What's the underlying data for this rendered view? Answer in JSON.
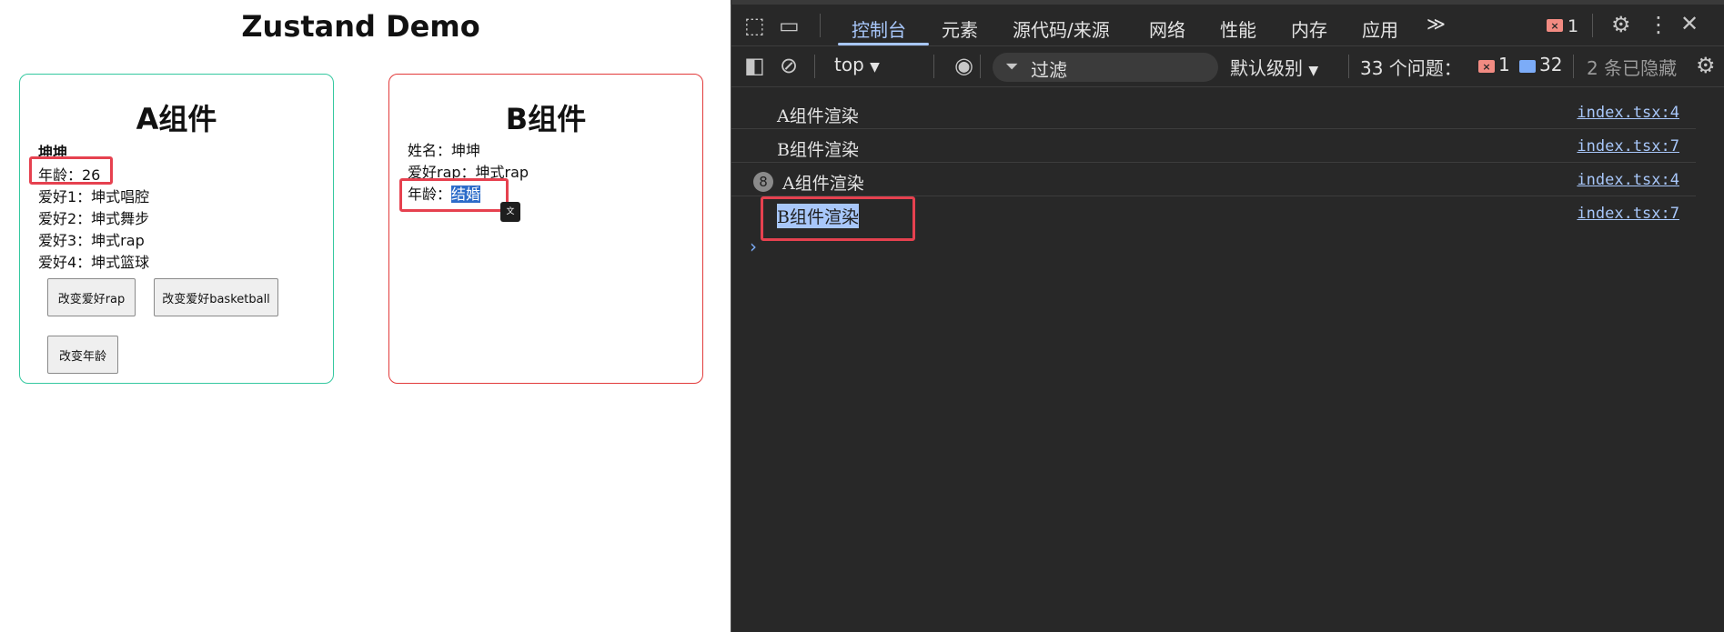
{
  "app": {
    "title": "Zustand Demo",
    "card_a": {
      "title": "A组件",
      "name": "坤坤",
      "age_line": "年龄：26",
      "hobbies": [
        "爱好1：坤式唱腔",
        "爱好2：坤式舞步",
        "爱好3：坤式rap",
        "爱好4：坤式篮球"
      ],
      "buttons": {
        "change_rap": "改变爱好rap",
        "change_basketball": "改变爱好basketball",
        "change_age": "改变年龄"
      }
    },
    "card_b": {
      "title": "B组件",
      "name_line": "姓名：坤坤",
      "hobby_line": "爱好rap：坤式rap",
      "age_label": "年龄：",
      "age_value": "结婚"
    },
    "colors": {
      "card_a_border": "#35c8a0",
      "card_b_border": "#e23b3b",
      "highlight_box": "#e6414f",
      "selection": "#2d6cc9"
    }
  },
  "devtools": {
    "tabs": [
      "控制台",
      "元素",
      "源代码/来源",
      "网络",
      "性能",
      "内存",
      "应用"
    ],
    "active_tab": "控制台",
    "more_tabs_glyph": "≫",
    "error_count": "1",
    "toolbar": {
      "context": "top",
      "filter_placeholder": "过滤",
      "level": "默认级别",
      "issues_label": "33 个问题：",
      "issues_errors": "1",
      "issues_messages": "32",
      "hidden": "2 条已隐藏"
    },
    "logs": [
      {
        "message": "A组件渲染",
        "source": "index.tsx:4",
        "count": ""
      },
      {
        "message": "B组件渲染",
        "source": "index.tsx:7",
        "count": ""
      },
      {
        "message": "A组件渲染",
        "source": "index.tsx:4",
        "count": "8"
      },
      {
        "message": "B组件渲染",
        "source": "index.tsx:7",
        "count": ""
      }
    ],
    "prompt_glyph": "›"
  }
}
